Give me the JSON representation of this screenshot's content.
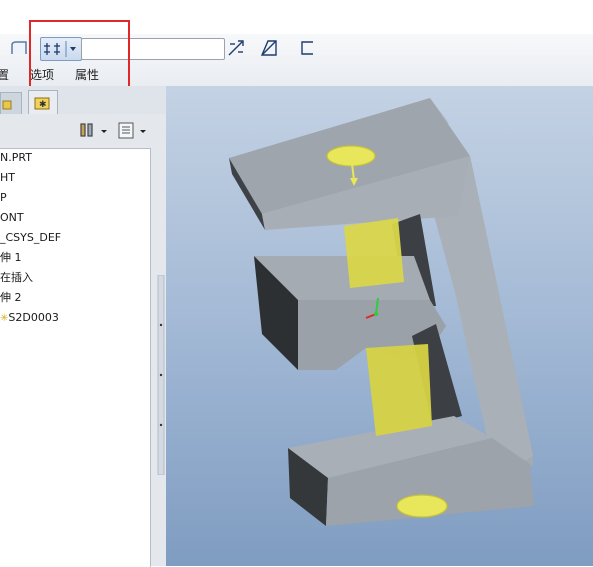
{
  "ribbon": {
    "label_partial_left": "置",
    "label_options": "选项",
    "label_properties": "属性",
    "search_value": ""
  },
  "model_tree": {
    "items": [
      {
        "label": "N.PRT"
      },
      {
        "label": "HT"
      },
      {
        "label": "P"
      },
      {
        "label": "ONT"
      },
      {
        "label": "_CSYS_DEF"
      },
      {
        "label": "伸 1"
      },
      {
        "label": "在插入"
      },
      {
        "label": "伸 2"
      },
      {
        "label": "S2D0003"
      }
    ]
  },
  "colors": {
    "highlight_box": "#e02828",
    "viewport_top": "#c4d2e4",
    "viewport_bottom": "#7f9cc1",
    "model_face": "#a6adb5",
    "cylinder": "#e8e65a"
  },
  "icons": {
    "sketch_tool": "sketch-icon",
    "depth_split": "depth-split-icon",
    "flip_direction": "flip-direction-icon",
    "remove_material": "remove-material-icon",
    "thicken": "thicken-icon"
  }
}
